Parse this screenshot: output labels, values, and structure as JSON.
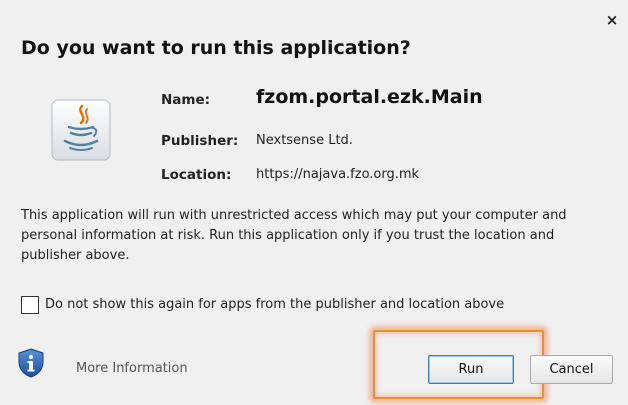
{
  "dialog": {
    "close_label": "×",
    "title": "Do you want to run this application?"
  },
  "app_info": {
    "name_label": "Name:",
    "name_value": "fzom.portal.ezk.Main",
    "publisher_label": "Publisher:",
    "publisher_value": "Nextsense Ltd.",
    "location_label": "Location:",
    "location_value": "https://najava.fzo.org.mk"
  },
  "warning_text": "This application will run with unrestricted access which may put your computer and personal information at risk. Run this application only if you trust the location and publisher above.",
  "checkbox": {
    "label": "Do not show this again for apps from the publisher and location above",
    "checked": false
  },
  "footer": {
    "more_info_label": "More Information",
    "run_label": "Run",
    "cancel_label": "Cancel"
  },
  "icons": {
    "app_icon": "java-icon",
    "info_icon": "shield-info-icon"
  },
  "colors": {
    "highlight": "#e3913a",
    "shield_blue": "#2f64b8",
    "java_orange": "#e76f00",
    "java_blue": "#5382a1"
  }
}
